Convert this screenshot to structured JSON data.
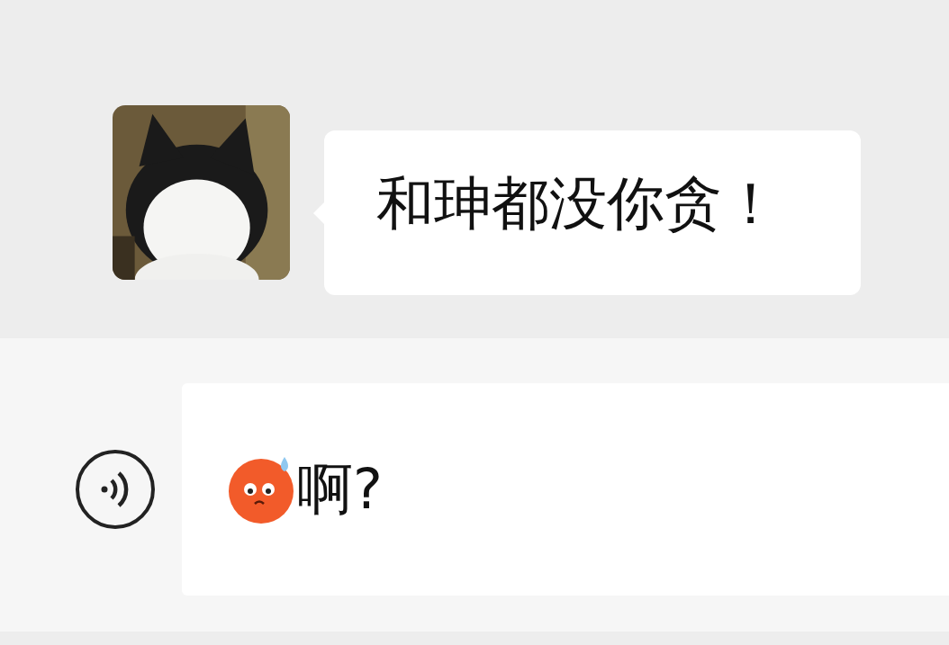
{
  "messages": [
    {
      "kind": "received",
      "text": "和珅都没你贪！"
    }
  ],
  "input": {
    "value": "啊?"
  }
}
